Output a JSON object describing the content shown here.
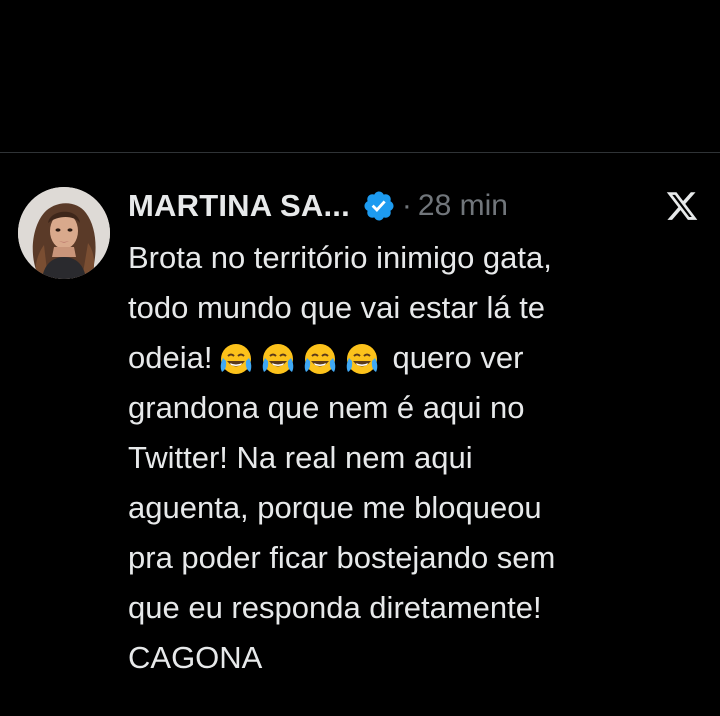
{
  "tweet": {
    "author_name": "MARTINA SA...",
    "separator": "·",
    "time": "28 min",
    "verified_icon": "verified-badge-icon",
    "platform_icon": "x-logo-icon",
    "avatar": "author-avatar",
    "text_lines": [
      "Brota no território inimigo gata,",
      "todo mundo que vai estar lá te",
      "odeia!",
      "quero ver",
      "grandona que nem é aqui no",
      "Twitter! Na real nem aqui",
      "aguenta, porque me bloqueou",
      "pra poder ficar bostejando sem",
      "que eu responda diretamente!",
      "CAGONA"
    ],
    "emoji_icon": "face-with-tears-of-joy-icon",
    "colors": {
      "background": "#000000",
      "text": "#e7e9ea",
      "secondary_text": "#71767b",
      "verified_blue": "#1d9bf0"
    }
  }
}
